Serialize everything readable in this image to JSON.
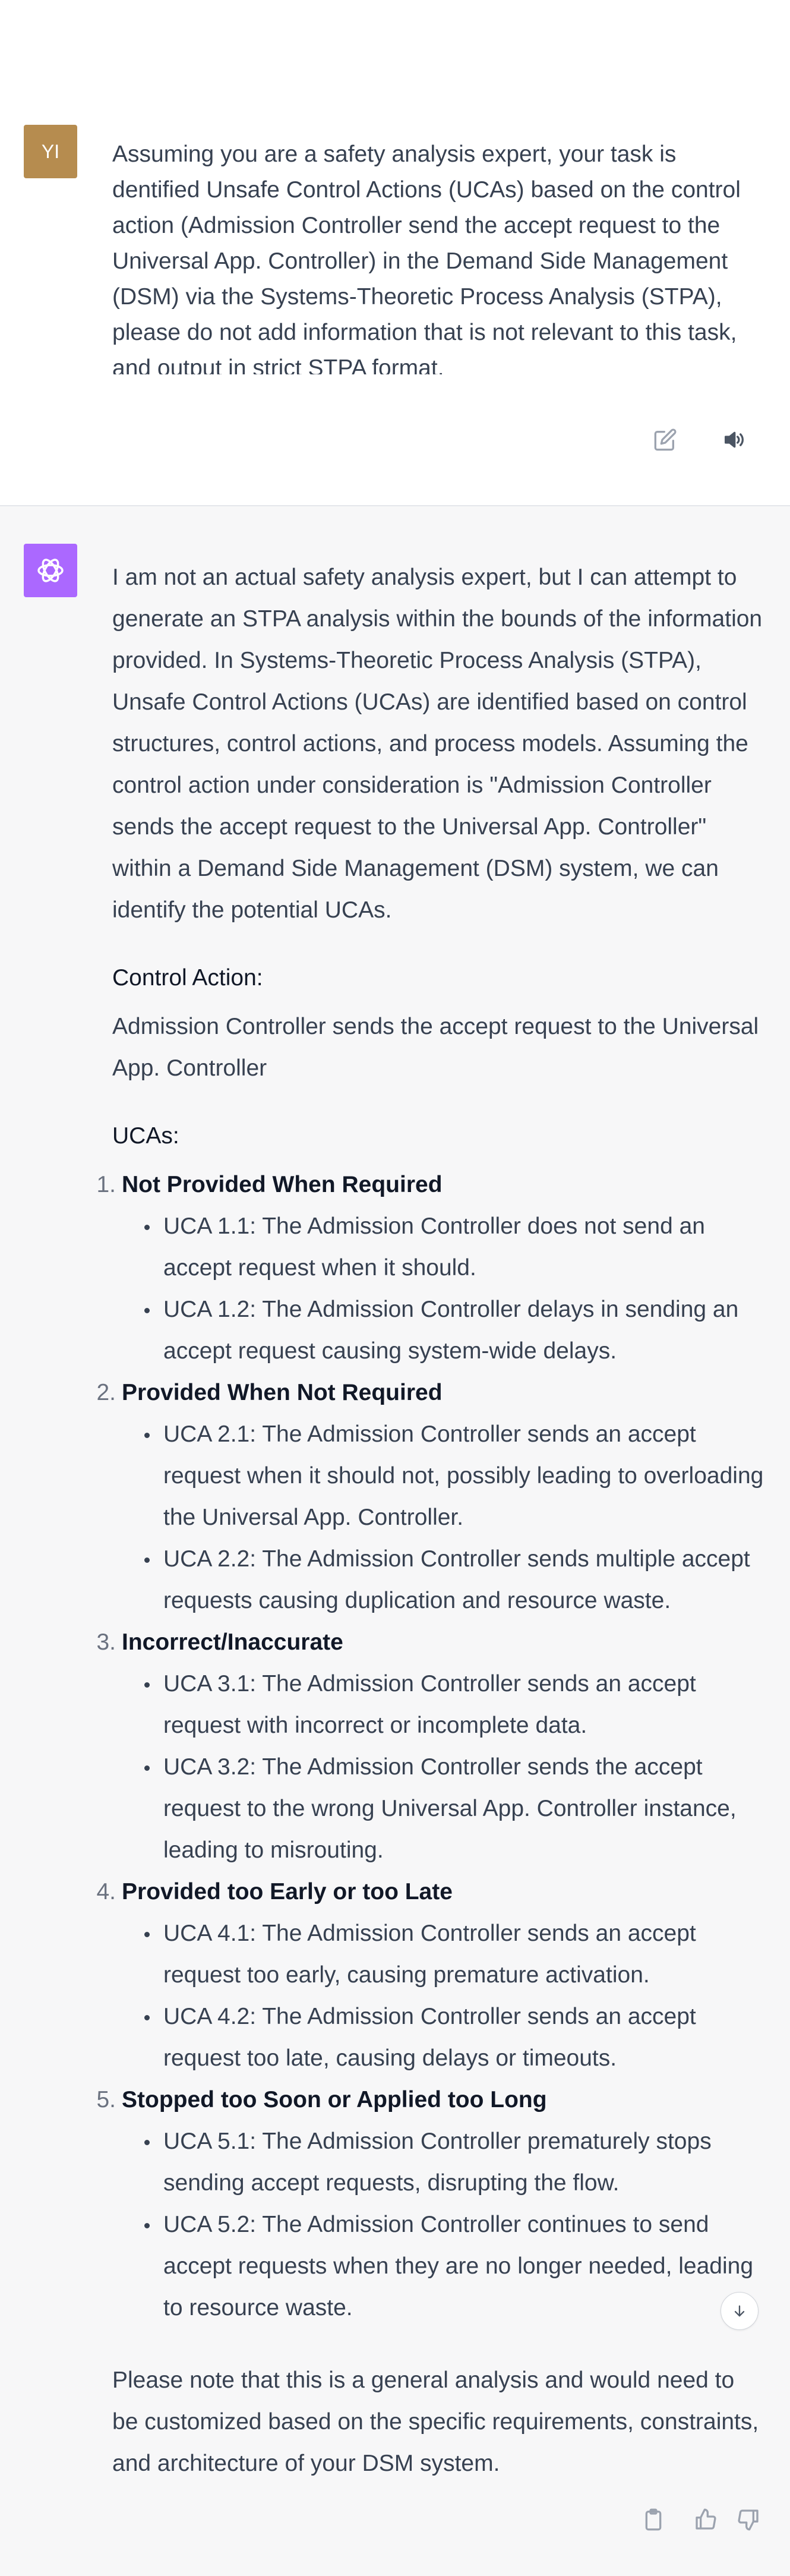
{
  "user_message": {
    "avatar_initials": "YI",
    "text": "Assuming you are a safety analysis expert, your task is dentified Unsafe Control Actions (UCAs) based on the control action (Admission Controller send the accept request to the Universal App. Controller) in the Demand Side Management (DSM) via the Systems-Theoretic Process Analysis (STPA), please do not add information that is not relevant to this task, and output in strict STPA format."
  },
  "assistant_message": {
    "intro": "I am not an actual safety analysis expert, but I can attempt to generate an STPA analysis within the bounds of the information provided. In Systems-Theoretic Process Analysis (STPA), Unsafe Control Actions (UCAs) are identified based on control structures, control actions, and process models. Assuming the control action under consideration is \"Admission Controller sends the accept request to the Universal App. Controller\" within a Demand Side Management (DSM) system, we can identify the potential UCAs.",
    "control_action_label": "Control Action:",
    "control_action": "Admission Controller sends the accept request to the Universal App. Controller",
    "ucas_label": "UCAs:",
    "categories": [
      {
        "number": "1.",
        "title": "Not Provided When Required",
        "items": [
          "UCA 1.1: The Admission Controller does not send an accept request when it should.",
          "UCA 1.2: The Admission Controller delays in sending an accept request causing system-wide delays."
        ]
      },
      {
        "number": "2.",
        "title": "Provided When Not Required",
        "items": [
          "UCA 2.1: The Admission Controller sends an accept request when it should not, possibly leading to overloading the Universal App. Controller.",
          "UCA 2.2: The Admission Controller sends multiple accept requests causing duplication and resource waste."
        ]
      },
      {
        "number": "3.",
        "title": "Incorrect/Inaccurate",
        "items": [
          "UCA 3.1: The Admission Controller sends an accept request with incorrect or incomplete data.",
          "UCA 3.2: The Admission Controller sends the accept request to the wrong Universal App. Controller instance, leading to misrouting."
        ]
      },
      {
        "number": "4.",
        "title": "Provided too Early or too Late",
        "items": [
          "UCA 4.1: The Admission Controller sends an accept request too early, causing premature activation.",
          "UCA 4.2: The Admission Controller sends an accept request too late, causing delays or timeouts."
        ]
      },
      {
        "number": "5.",
        "title": "Stopped too Soon or Applied too Long",
        "items": [
          "UCA 5.1: The Admission Controller prematurely stops sending accept requests, disrupting the flow.",
          "UCA 5.2: The Admission Controller continues to send accept requests when they are no longer needed, leading to resource waste."
        ]
      }
    ],
    "note": "Please note that this is a general analysis and would need to be customized based on the specific requirements, constraints, and architecture of your DSM system."
  },
  "colors": {
    "user_avatar": "#b68c4f",
    "assistant_avatar": "#ab68ff",
    "assistant_background": "#f7f7f8"
  },
  "icons": {
    "edit": "edit-icon",
    "speaker": "speaker-icon",
    "gpt_logo": "openai-logo-icon",
    "scroll_down": "arrow-down-icon",
    "copy": "clipboard-icon",
    "thumbs_up": "thumbs-up-icon",
    "thumbs_down": "thumbs-down-icon"
  }
}
